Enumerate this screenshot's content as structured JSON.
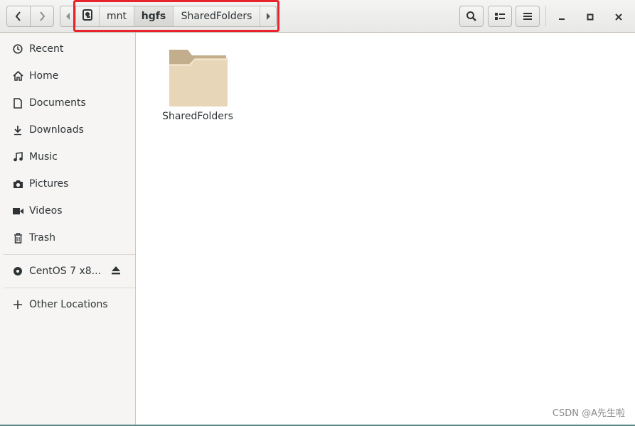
{
  "toolbar": {
    "back_icon": "chevron-left-icon",
    "forward_icon": "chevron-right-icon",
    "search_icon": "search-icon",
    "view_icon": "list-view-icon",
    "menu_icon": "hamburger-menu-icon"
  },
  "breadcrumb": {
    "items": [
      "mnt",
      "hgfs",
      "SharedFolders"
    ],
    "current": "hgfs"
  },
  "sidebar": {
    "places": [
      {
        "label": "Recent",
        "icon": "clock-icon"
      },
      {
        "label": "Home",
        "icon": "home-icon"
      },
      {
        "label": "Documents",
        "icon": "document-icon"
      },
      {
        "label": "Downloads",
        "icon": "download-icon"
      },
      {
        "label": "Music",
        "icon": "music-icon"
      },
      {
        "label": "Pictures",
        "icon": "camera-icon"
      },
      {
        "label": "Videos",
        "icon": "video-icon"
      },
      {
        "label": "Trash",
        "icon": "trash-icon"
      }
    ],
    "devices": [
      {
        "label": "CentOS 7 x8...",
        "icon": "disc-icon",
        "action_icon": "eject-icon"
      }
    ],
    "other": {
      "label": "Other Locations",
      "icon": "plus-icon"
    }
  },
  "content": {
    "items": [
      {
        "name": "SharedFolders",
        "type": "folder"
      }
    ]
  },
  "watermark": "CSDN @A先生啦",
  "colors": {
    "highlight_box": "#e8232a",
    "folder": "#e8d6b8"
  }
}
